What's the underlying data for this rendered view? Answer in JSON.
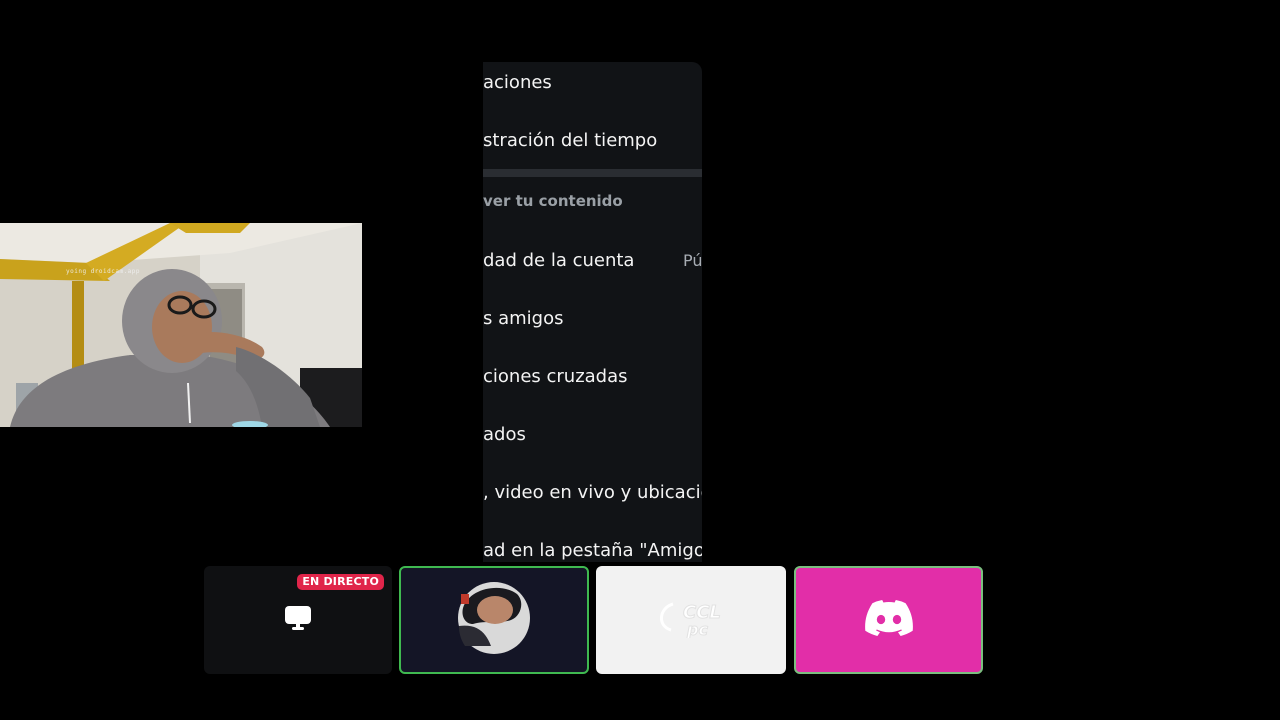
{
  "webcam": {
    "watermark": "yoing droidcam.app"
  },
  "settings_panel": {
    "rows_top": [
      {
        "label": "aciones"
      },
      {
        "label": "stración del tiempo"
      }
    ],
    "section_header": "ver tu contenido",
    "rows": [
      {
        "label": "dad de la cuenta",
        "value": "Pú"
      },
      {
        "label": "s amigos"
      },
      {
        "label": "ciones cruzadas"
      },
      {
        "label": "ados"
      },
      {
        "label": ", video en vivo y ubicación"
      },
      {
        "label": "ad en la pestaña \"Amigos\""
      }
    ]
  },
  "thumbnails": [
    {
      "name": "live-screen",
      "badge": "EN DIRECTO",
      "icon": "monitor-icon",
      "background": "#0f1012"
    },
    {
      "name": "avatar-stream",
      "icon": "profile-photo",
      "background": "#141526",
      "selected": true
    },
    {
      "name": "game-logo",
      "icon": "logo-icon",
      "background": "#f2f2f2"
    },
    {
      "name": "discord",
      "icon": "discord-icon",
      "background": "#e22ea8"
    }
  ],
  "colors": {
    "page_background": "#000000",
    "panel_background": "#111316",
    "live_badge": "#e0254a",
    "selected_border": "#3fb950",
    "discord_pink": "#e22ea8"
  }
}
